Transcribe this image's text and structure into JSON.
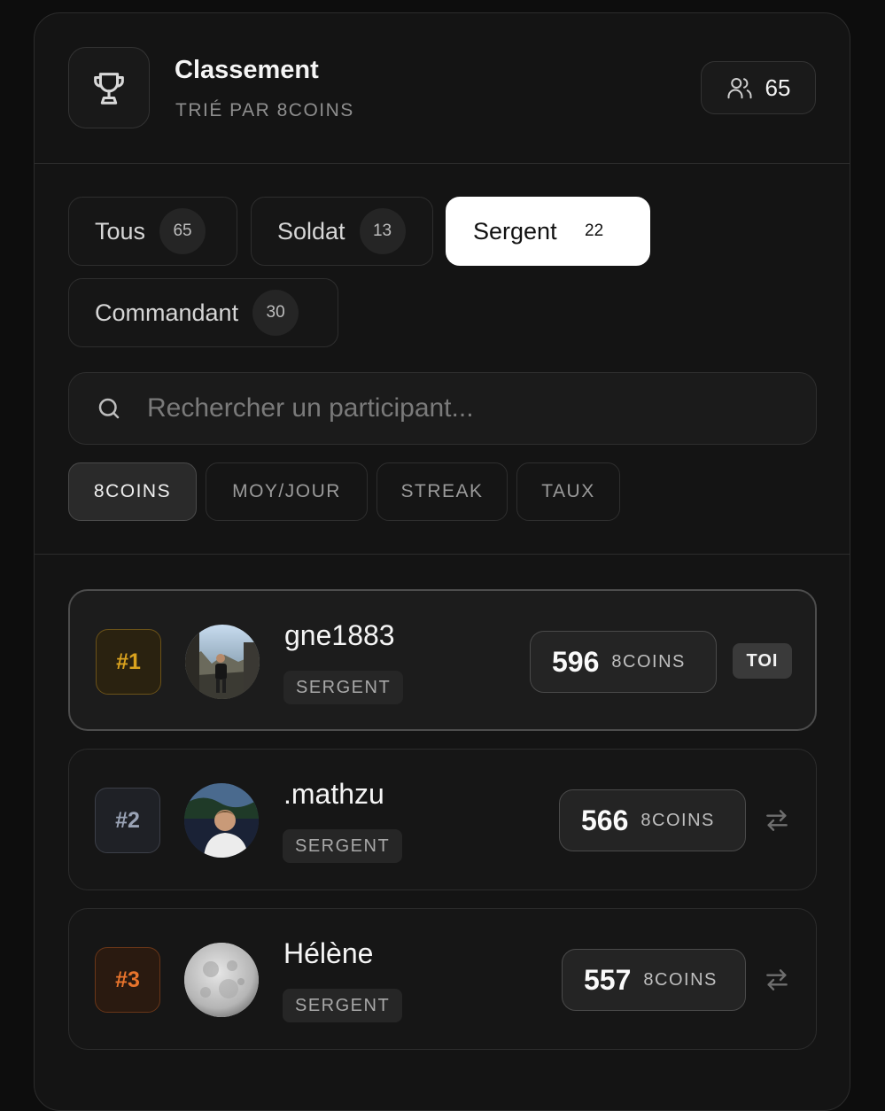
{
  "header": {
    "title": "Classement",
    "subtitle": "TRIÉ PAR 8COINS",
    "participant_count": "65",
    "trophy_icon": "trophy-icon",
    "users_icon": "users-icon"
  },
  "tabs": [
    {
      "label": "Tous",
      "count": "65",
      "active": false
    },
    {
      "label": "Soldat",
      "count": "13",
      "active": false
    },
    {
      "label": "Sergent",
      "count": "22",
      "active": true
    },
    {
      "label": "Commandant",
      "count": "30",
      "active": false
    }
  ],
  "search": {
    "placeholder": "Rechercher un participant...",
    "value": ""
  },
  "sort": [
    {
      "label": "8COINS",
      "active": true
    },
    {
      "label": "MOY/JOUR",
      "active": false
    },
    {
      "label": "STREAK",
      "active": false
    },
    {
      "label": "TAUX",
      "active": false
    }
  ],
  "rows": [
    {
      "rank": "#1",
      "name": "gne1883",
      "grade": "SERGENT",
      "score": "596",
      "unit": "8COINS",
      "tag": "TOI"
    },
    {
      "rank": "#2",
      "name": ".mathzu",
      "grade": "SERGENT",
      "score": "566",
      "unit": "8COINS"
    },
    {
      "rank": "#3",
      "name": "Hélène",
      "grade": "SERGENT",
      "score": "557",
      "unit": "8COINS"
    }
  ],
  "colors": {
    "rank1": "#d9a21e",
    "rank2": "#9aa3b5",
    "rank3": "#e8742c",
    "active_tab_bg": "#ffffff"
  }
}
